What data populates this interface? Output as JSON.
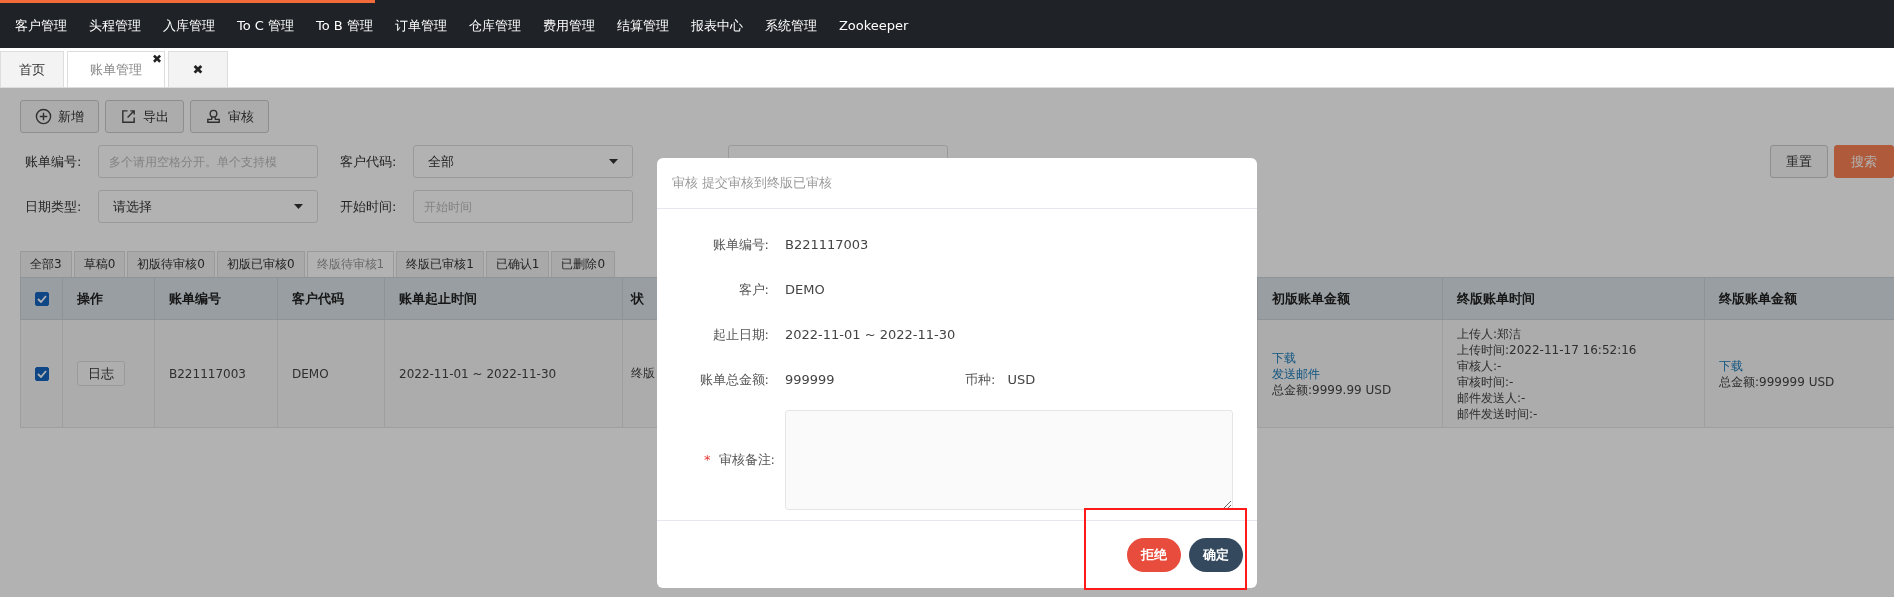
{
  "nav": {
    "items": [
      "客户管理",
      "头程管理",
      "入库管理",
      "To C 管理",
      "To B 管理",
      "订单管理",
      "仓库管理",
      "费用管理",
      "结算管理",
      "报表中心",
      "系统管理",
      "Zookeeper"
    ]
  },
  "page_tabs": [
    {
      "label": "首页",
      "selected": false
    },
    {
      "label": "账单管理",
      "selected": true,
      "close": "✖"
    },
    {
      "close": "✖",
      "selected": false
    }
  ],
  "toolbar": [
    {
      "label": "新增",
      "kind": "add"
    },
    {
      "label": "导出",
      "kind": "export"
    },
    {
      "label": "审核",
      "kind": "audit"
    }
  ],
  "filters": [
    [
      {
        "label": "账单编号:",
        "kind": "input",
        "placeholder": "多个请用空格分开。单个支持模"
      },
      {
        "label": "客户代码:",
        "kind": "select",
        "value": "全部"
      },
      {
        "kind": "input"
      }
    ],
    [
      {
        "label": "日期类型:",
        "kind": "select",
        "value": "请选择"
      },
      {
        "label": "开始时间:",
        "kind": "input",
        "placeholder": "开始时间"
      }
    ]
  ],
  "actions": [
    {
      "label": "重置",
      "kind": "reset"
    },
    {
      "label": "搜索",
      "kind": "search"
    }
  ],
  "status_tabs": [
    {
      "label": "全部3",
      "selected": false
    },
    {
      "label": "草稿0",
      "selected": false
    },
    {
      "label": "初版待审核0",
      "selected": false
    },
    {
      "label": "初版已审核0",
      "selected": false
    },
    {
      "label": "终版待审核1",
      "selected": true
    },
    {
      "label": "终版已审核1",
      "selected": false
    },
    {
      "label": "已确认1",
      "selected": false
    },
    {
      "label": "已删除0",
      "selected": false
    }
  ],
  "table": {
    "all_checked": true,
    "columns": [
      "操作",
      "账单编号",
      "客户代码",
      "账单起止时间",
      "状",
      "初版账单金额",
      "终版账单时间",
      "终版账单金额"
    ],
    "rows": [
      {
        "checked": true,
        "action": "日志",
        "bill_no": "B221117003",
        "customer": "DEMO",
        "period": "2022-11-01 ~ 2022-11-30",
        "status": "终版",
        "first_amount": {
          "links": [
            "下载",
            "发送邮件"
          ],
          "total": "总金额:9999.99 USD"
        },
        "final_time": [
          "上传人:郑洁",
          "上传时间:2022-11-17 16:52:16",
          "审核人:-",
          "审核时间:-",
          "邮件发送人:-",
          "邮件发送时间:-"
        ],
        "final_amount": {
          "links": [
            "下载"
          ],
          "total": "总金额:999999 USD"
        }
      }
    ]
  },
  "modal": {
    "title": "审核 提交审核到终版已审核",
    "rows": [
      [
        {
          "label": "账单编号:",
          "value": "B221117003"
        }
      ],
      [
        {
          "label": "客户:",
          "value": "DEMO"
        }
      ],
      [
        {
          "label": "起止日期:",
          "value": "2022-11-01 ~ 2022-11-30"
        }
      ],
      [
        {
          "label": "账单总金额:",
          "value": "999999"
        },
        {
          "label": "币种:",
          "value": "USD"
        }
      ]
    ],
    "remark": {
      "label": "审核备注:",
      "required": true,
      "required_mark": "*"
    },
    "buttons": [
      {
        "label": "拒绝",
        "kind": "reject"
      },
      {
        "label": "确定",
        "kind": "confirm"
      }
    ],
    "buttons_highlighted": true
  }
}
